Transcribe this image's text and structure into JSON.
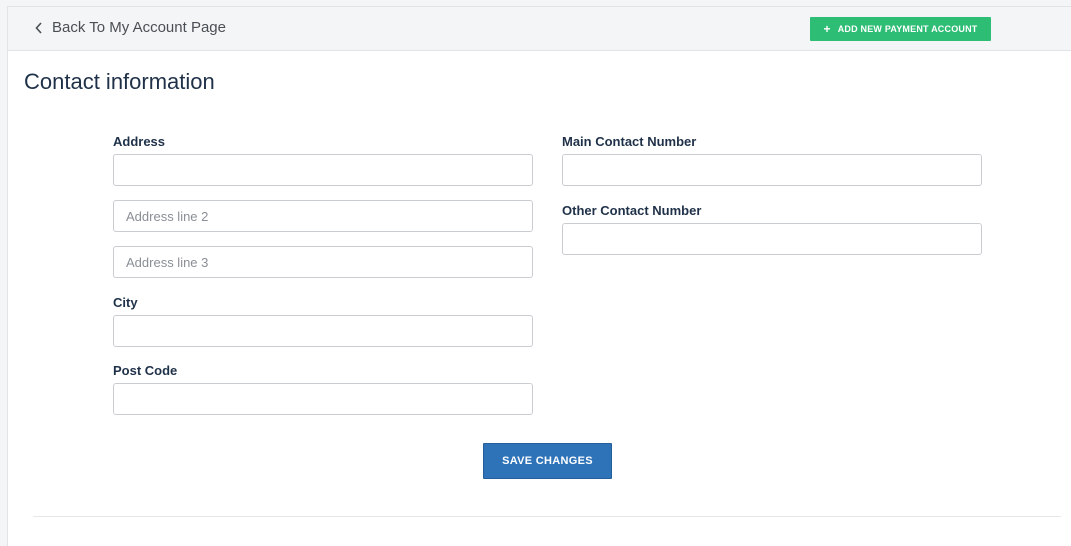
{
  "header": {
    "back_label": "Back To My Account Page",
    "add_payment_label": "ADD NEW PAYMENT ACCOUNT"
  },
  "page": {
    "title": "Contact information"
  },
  "form": {
    "address_label": "Address",
    "address_line1": {
      "value": "",
      "placeholder": ""
    },
    "address_line2": {
      "value": "",
      "placeholder": "Address line 2"
    },
    "address_line3": {
      "value": "",
      "placeholder": "Address line 3"
    },
    "city_label": "City",
    "city": {
      "value": "",
      "placeholder": ""
    },
    "post_code_label": "Post Code",
    "post_code": {
      "value": "",
      "placeholder": ""
    },
    "main_contact_label": "Main Contact Number",
    "main_contact": {
      "value": "",
      "placeholder": ""
    },
    "other_contact_label": "Other Contact Number",
    "other_contact": {
      "value": "",
      "placeholder": ""
    },
    "save_label": "SAVE CHANGES"
  },
  "colors": {
    "accent_green": "#2dbd74",
    "primary_blue": "#2e72b8",
    "heading_navy": "#1f3148"
  },
  "icons": {
    "back": "chevron-left-icon",
    "add": "plus-icon"
  }
}
